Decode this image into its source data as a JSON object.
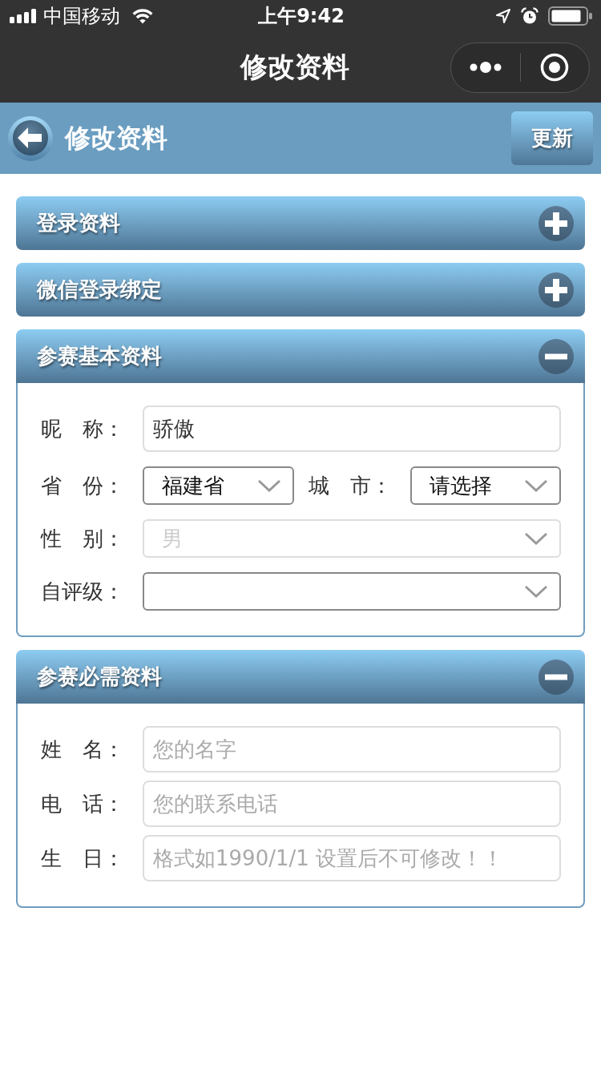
{
  "status_bar": {
    "carrier": "中国移动",
    "time": "上午9:42"
  },
  "nav_bar": {
    "title": "修改资料"
  },
  "header": {
    "title": "修改资料",
    "button": "更新"
  },
  "sections": [
    {
      "title": "登录资料",
      "expanded": false
    },
    {
      "title": "微信登录绑定",
      "expanded": false
    },
    {
      "title": "参赛基本资料",
      "expanded": true,
      "rows": [
        {
          "kind": "input",
          "label": "昵　称：",
          "value": "骄傲"
        },
        {
          "kind": "select_pair",
          "fields": [
            {
              "label": "省　份：",
              "value": "福建省",
              "disabled": false
            },
            {
              "label": "城　市：",
              "value": "请选择",
              "disabled": false
            }
          ]
        },
        {
          "kind": "select",
          "label": "性　别：",
          "value": "男",
          "disabled": true
        },
        {
          "kind": "select",
          "label": "自评级：",
          "disabled": false
        }
      ]
    },
    {
      "title": "参赛必需资料",
      "expanded": true,
      "rows": [
        {
          "kind": "input",
          "label": "姓　名：",
          "placeholder": "您的名字"
        },
        {
          "kind": "input",
          "label": "电　话：",
          "placeholder": "您的联系电话"
        },
        {
          "kind": "input",
          "label": "生　日：",
          "placeholder": "格式如1990/1/1 设置后不可修改！！"
        }
      ]
    }
  ]
}
